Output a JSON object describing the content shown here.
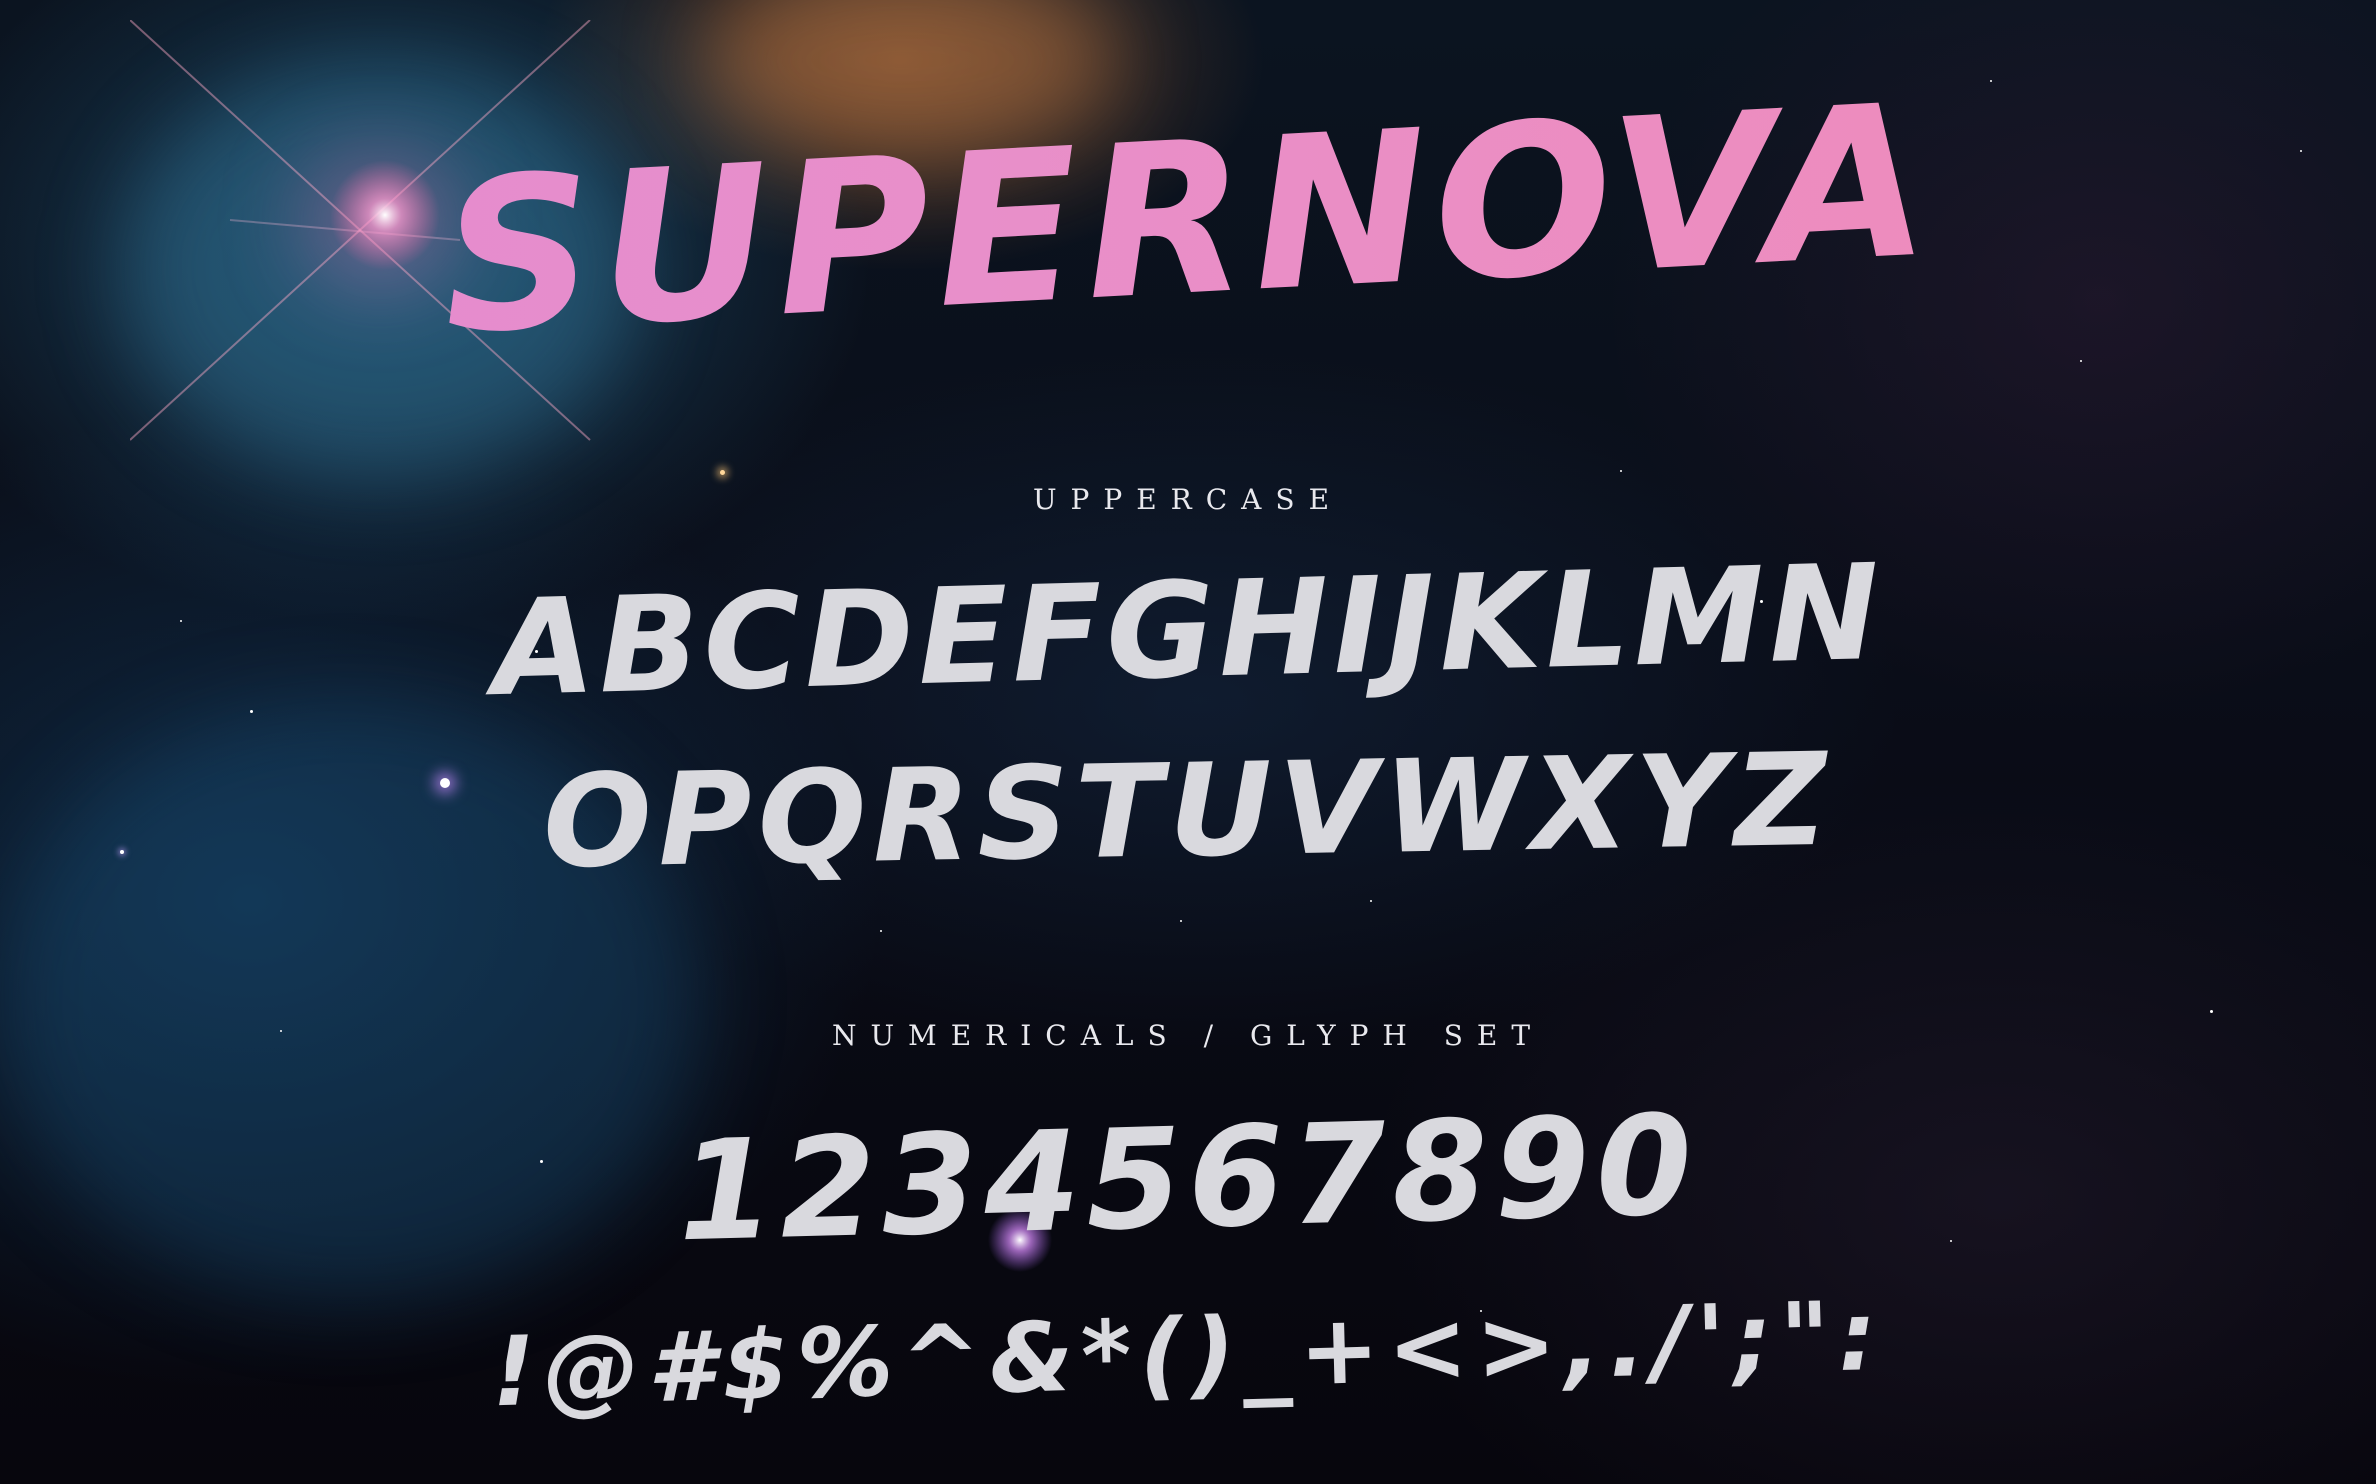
{
  "title": "SUPERNOVA",
  "sections": {
    "uppercase_label": "UPPERCASE",
    "uppercase_row1": "ABCDEFGHIJKLMN",
    "uppercase_row2": "OPQRSTUVWXYZ",
    "numericals_label": "NUMERICALS / GLYPH SET",
    "numbers_row": "1234567890",
    "symbols_row": "!@#$%^&*()_+<>,./';\":"
  },
  "colors": {
    "title_pink": "#e48ac6",
    "glyph_white": "#d9d9de",
    "background": "#07070d"
  }
}
